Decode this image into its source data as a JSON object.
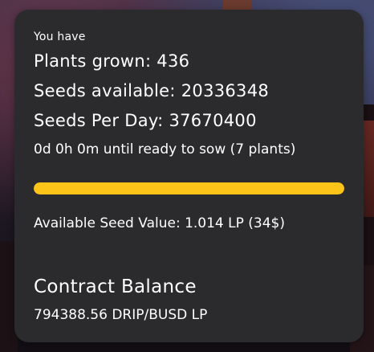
{
  "card": {
    "intro": "You have",
    "plants_grown": "Plants grown: 436",
    "seeds_available": "Seeds available: 20336348",
    "seeds_per_day": "Seeds Per Day: 37670400",
    "sow_status": "0d 0h 0m until ready to sow (7 plants)",
    "progress_fraction": 1.0,
    "available_seed_value": "Available Seed Value: 1.014 LP (34$)",
    "contract_heading": "Contract Balance",
    "contract_balance": "794388.56 DRIP/BUSD LP"
  },
  "colors": {
    "card_background": "#2b2b2e",
    "progress_fill": "#fcc419",
    "text": "#ffffff"
  }
}
